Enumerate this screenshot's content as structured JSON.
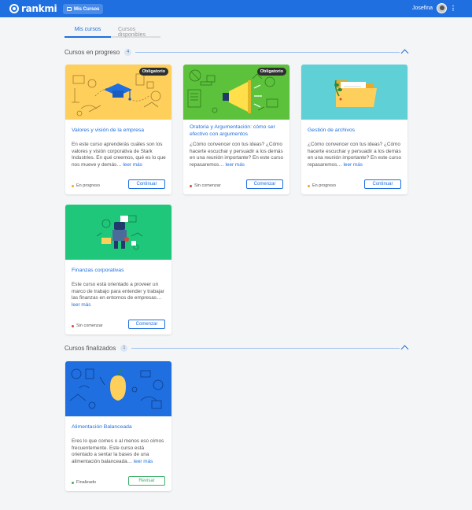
{
  "header": {
    "brand": "rankmi",
    "mis_cursos_btn": "Mis Cursos",
    "user_name": "Josefina",
    "more_symbol": "⋮"
  },
  "tabs": [
    {
      "label": "Mis cursos",
      "active": true
    },
    {
      "label": "Cursos disponibles",
      "active": false
    }
  ],
  "sections": {
    "in_progress": {
      "title": "Cursos en progreso",
      "count": "4",
      "courses": [
        {
          "title": "Valores y visión de la empresa",
          "description": "En este curso aprenderás cuáles son los valores y visión corporativa de Stark Industries. En qué creemos, qué es lo que nos mueve y demás…",
          "read_more": "leer más",
          "status": "En progreso",
          "action": "Continuar",
          "badge": "Obligatorio"
        },
        {
          "title": "Oratoria y Argumentación: cómo ser efectivo con argumentos",
          "description": "¿Cómo convencer con tus ideas? ¿Cómo hacerte escuchar y persuadir a los demás en una reunión importante? En este curso repasaremos…",
          "read_more": "leer más",
          "status": "Sin comenzar",
          "action": "Comenzar",
          "badge": "Obligatorio"
        },
        {
          "title": "Gestión de archivos",
          "description": "¿Cómo convencer con tus ideas? ¿Cómo hacerte escuchar y persuadir a los demás en una reunión importante? En este curso repasaremos…",
          "read_more": "leer más",
          "status": "En progreso",
          "action": "Continuar"
        },
        {
          "title": "Finanzas corporativas",
          "description": "Este curso está orientado a proveer un marco de trabajo para entender y trabajar las finanzas en entornos de empresas…",
          "read_more": "leer más",
          "status": "Sin comenzar",
          "action": "Comenzar"
        }
      ]
    },
    "finished": {
      "title": "Cursos finalizados",
      "count": "1",
      "courses": [
        {
          "title": "Alimentación Balanceada",
          "description": "Eres lo que comes o al menos eso oímos frecuentemente. Este curso está orientado a sentar la bases de una alimentación balanceada…",
          "read_more": "leer más",
          "status": "Finalizado",
          "action": "Revisar"
        }
      ]
    }
  },
  "colors": {
    "brand_blue": "#1f6fe0",
    "status_in_progress": "#f5a623",
    "status_not_started": "#e0463a",
    "status_finished": "#3fae6a",
    "card1_bg": "#ffcf5c",
    "card2_bg": "#5cc23c",
    "card3_bg": "#5ed0d6",
    "card4_bg": "#1fc77a",
    "card5_bg": "#1f6fe0"
  },
  "icons": [
    "logo-icon",
    "course-list-icon",
    "avatar",
    "chevron-up-icon"
  ]
}
